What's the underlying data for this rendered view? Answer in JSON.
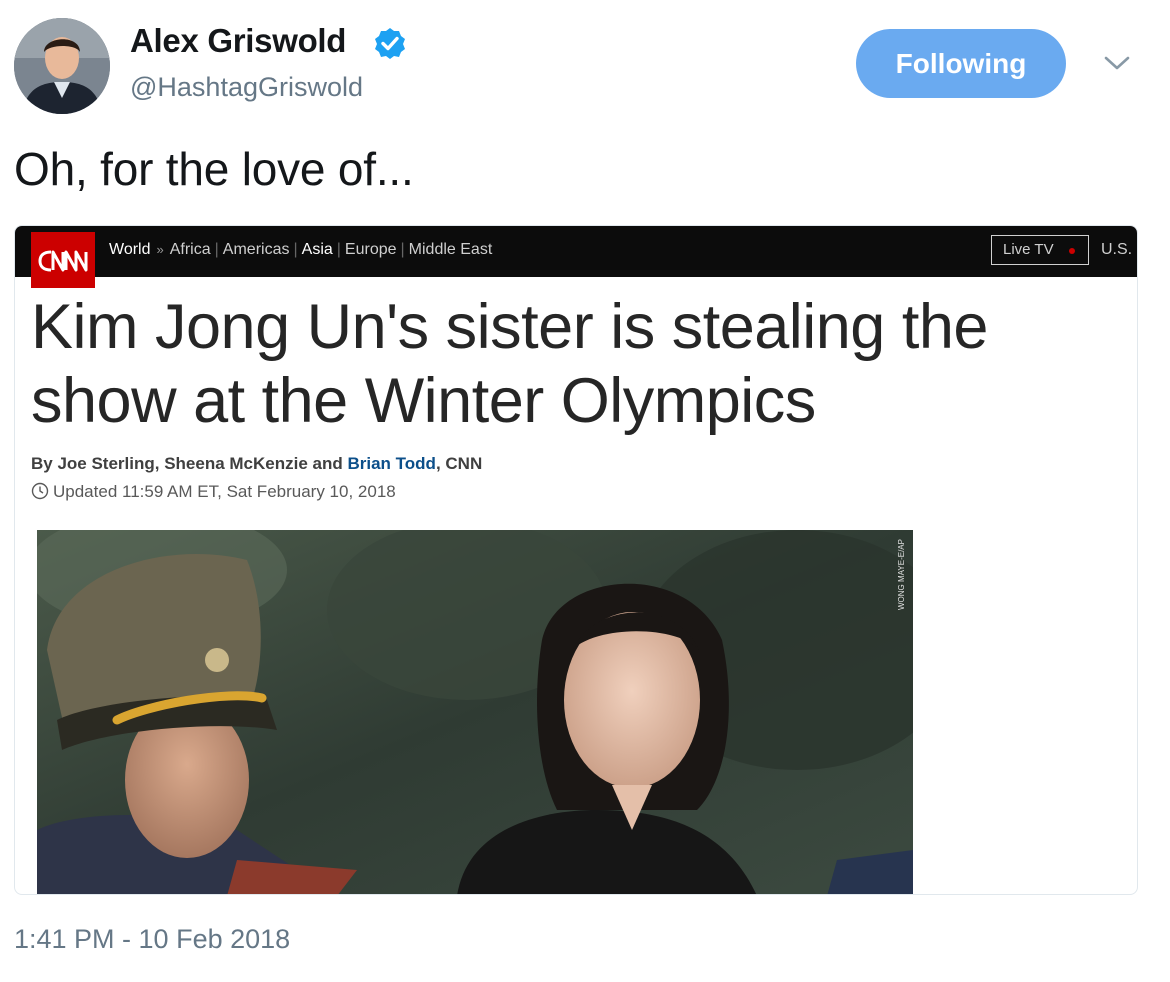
{
  "tweet": {
    "author_name": "Alex Griswold",
    "handle": "@HashtagGriswold",
    "follow_label": "Following",
    "text": "Oh, for the love of...",
    "timestamp": "1:41 PM - 10 Feb 2018",
    "icons": {
      "verified": "verified-badge-icon",
      "caret": "chevron-down-icon",
      "avatar": "avatar"
    }
  },
  "card": {
    "nav": {
      "world": "World",
      "arrow": "»",
      "links": [
        "Africa",
        "Americas",
        "Asia",
        "Europe",
        "Middle East"
      ],
      "active": "Asia",
      "live_tv": "Live TV",
      "us": "U.S."
    },
    "headline": "Kim Jong Un's sister is stealing the show at the Winter Olympics",
    "byline": {
      "prefix": "By Joe Sterling, Sheena McKenzie and ",
      "link": "Brian Todd",
      "suffix": ", CNN"
    },
    "updated": "Updated 11:59 AM ET, Sat February 10, 2018",
    "photo_credit": "WONG MAYE-E/AP"
  },
  "colors": {
    "follow_button": "#6aaaf0",
    "cnn_red": "#cc0000",
    "verified_blue": "#1da1f2",
    "byline_link": "#0c4f8a"
  }
}
